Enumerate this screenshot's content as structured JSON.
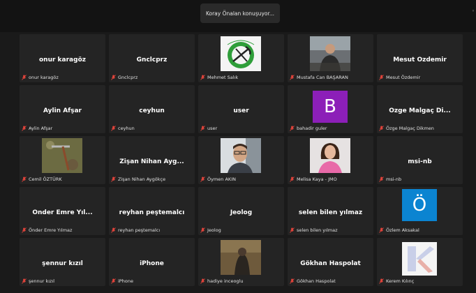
{
  "header": {
    "speaker_banner": "Koray Önalan konuşuyor..."
  },
  "tiles": [
    {
      "display": "onur karagöz",
      "label": "onur karagöz",
      "kind": "name"
    },
    {
      "display": "Gnclcprz",
      "label": "Gnclcprz",
      "kind": "name"
    },
    {
      "display": "",
      "label": "Mehmet Salık",
      "kind": "photo",
      "image": "maden-muhendisligi-logo"
    },
    {
      "display": "",
      "label": "Mustafa Can BAŞARAN",
      "kind": "photo",
      "image": "person-photo"
    },
    {
      "display": "Mesut Özdemir",
      "label": "Mesut Özdemir",
      "kind": "name"
    },
    {
      "display": "Aylin Afşar",
      "label": "Aylin Afşar",
      "kind": "name"
    },
    {
      "display": "ceyhun",
      "label": "ceyhun",
      "kind": "name"
    },
    {
      "display": "user",
      "label": "user",
      "kind": "name"
    },
    {
      "display": "B",
      "label": "bahadir guler",
      "kind": "letter",
      "color": "#8c1fb8"
    },
    {
      "display": "Özge Malgaç Di...",
      "label": "Özge Malgaç Dikmen",
      "kind": "name"
    },
    {
      "display": "",
      "label": "Cemil ÖZTÜRK",
      "kind": "photo",
      "image": "rock-hammer-photo"
    },
    {
      "display": "Zişan Nihan Ayg...",
      "label": "Zişan Nihan Aygökçe",
      "kind": "name"
    },
    {
      "display": "",
      "label": "Öymen AKIN",
      "kind": "photo",
      "image": "person-photo"
    },
    {
      "display": "",
      "label": "Melisa Kaya - JMO",
      "kind": "photo",
      "image": "person-photo"
    },
    {
      "display": "msi-nb",
      "label": "msi-nb",
      "kind": "name"
    },
    {
      "display": "Önder Emre Yıl...",
      "label": "Önder Emre Yılmaz",
      "kind": "name"
    },
    {
      "display": "reyhan peştemalcı",
      "label": "reyhan peştemalcı",
      "kind": "name"
    },
    {
      "display": "Jeolog",
      "label": "Jeolog",
      "kind": "name"
    },
    {
      "display": "selen bilen yılmaz",
      "label": "selen bilen yılmaz",
      "kind": "name"
    },
    {
      "display": "Ö",
      "label": "Özlem Aksakal",
      "kind": "letter",
      "color": "#0b84d1"
    },
    {
      "display": "şennur kızıl",
      "label": "şennur kızıl",
      "kind": "name"
    },
    {
      "display": "iPhone",
      "label": "iPhone",
      "kind": "name"
    },
    {
      "display": "",
      "label": "hadiye inceoglu",
      "kind": "photo",
      "image": "person-photo"
    },
    {
      "display": "Gökhan Haspolat",
      "label": "Gökhan Haspolat",
      "kind": "name"
    },
    {
      "display": "",
      "label": "Kerem Kılınç",
      "kind": "logo",
      "image": "k-logo"
    }
  ],
  "icons": {
    "mic": "muted-microphone-icon"
  },
  "colors": {
    "background": "#1a1a1a",
    "tile": "#242424",
    "muted_mic": "#e8453c"
  }
}
